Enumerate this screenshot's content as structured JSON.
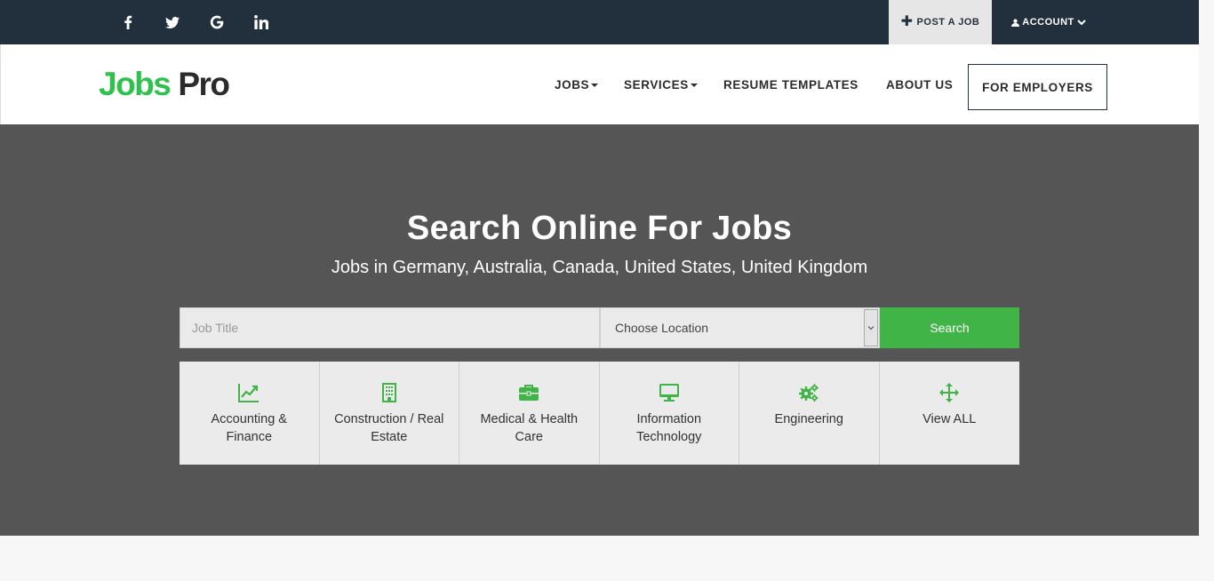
{
  "topbar": {
    "social": [
      "facebook-icon",
      "twitter-icon",
      "google-icon",
      "linkedin-icon"
    ],
    "post_job": "POST A JOB",
    "account": "ACCOUNT"
  },
  "nav": {
    "logo_part1": "Jobs",
    "logo_part2": "Pro",
    "items": [
      "JOBS",
      "SERVICES",
      "RESUME TEMPLATES",
      "ABOUT US"
    ],
    "employers": "FOR EMPLOYERS"
  },
  "hero": {
    "title": "Search Online For Jobs",
    "subtitle": "Jobs in Germany, Australia, Canada, United States, United Kingdom",
    "job_placeholder": "Job Title",
    "location_value": "Choose Location",
    "search_label": "Search"
  },
  "categories": [
    {
      "label": "Accounting & Finance",
      "icon": "chart-line-icon"
    },
    {
      "label": "Construction / Real Estate",
      "icon": "building-icon"
    },
    {
      "label": "Medical & Health Care",
      "icon": "briefcase-icon"
    },
    {
      "label": "Information Technology",
      "icon": "monitor-icon"
    },
    {
      "label": "Engineering",
      "icon": "gears-icon"
    },
    {
      "label": "View ALL",
      "icon": "arrows-move-icon"
    }
  ],
  "colors": {
    "accent_green": "#41b447",
    "logo_green": "#2ec24d",
    "topbar": "#222f3d",
    "hero_bg": "#555555"
  }
}
